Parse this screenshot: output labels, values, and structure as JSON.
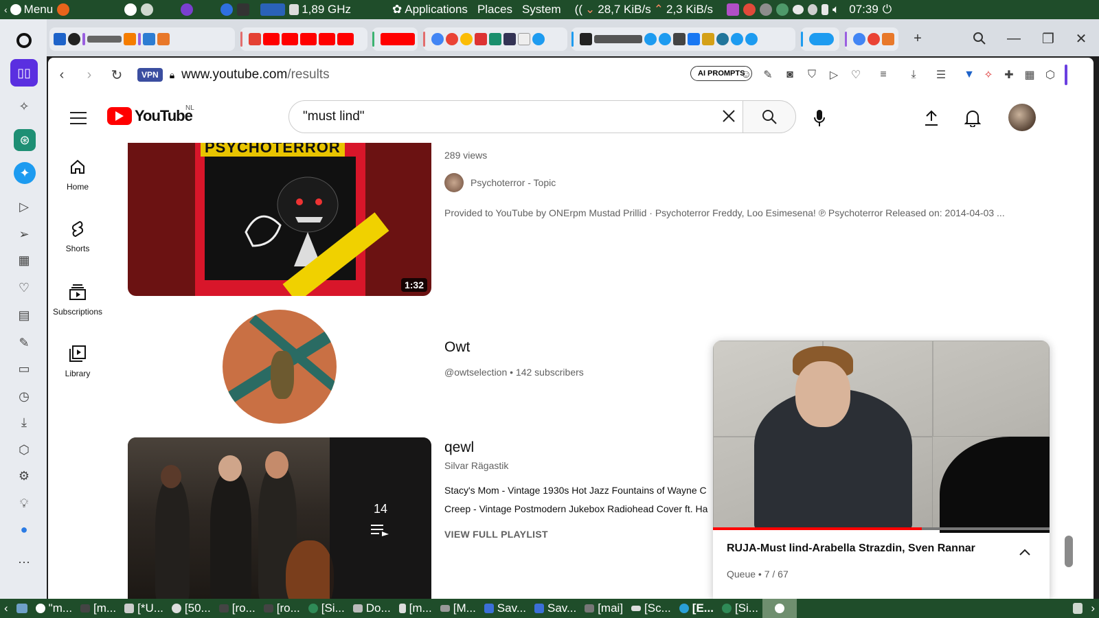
{
  "topbar": {
    "menu_label": "Menu",
    "cpu_freq": "1,89 GHz",
    "apps": [
      "Applications",
      "Places",
      "System"
    ],
    "net_down": "28,7 KiB/s",
    "net_up": "2,3 KiB/s",
    "clock": "07:39"
  },
  "address": {
    "vpn": "VPN",
    "url_host": "www.youtube.com",
    "url_path": "/results",
    "ai_prompts": "AI PROMPTS"
  },
  "youtube": {
    "logo_text": "YouTube",
    "region": "NL",
    "search_query": "\"must lind\"",
    "sidebar": [
      {
        "label": "Home",
        "icon": "home-icon"
      },
      {
        "label": "Shorts",
        "icon": "shorts-icon"
      },
      {
        "label": "Subscriptions",
        "icon": "subscriptions-icon"
      },
      {
        "label": "Library",
        "icon": "library-icon"
      }
    ],
    "result1": {
      "album_text": "PSYCHOTERROR",
      "duration": "1:32",
      "views": "289 views",
      "channel": "Psychoterror - Topic",
      "description": "Provided to YouTube by ONErpm Mustad Prillid · Psychoterror Freddy, Loo Esimesena! ℗ Psychoterror Released on: 2014-04-03 ..."
    },
    "result2": {
      "name": "Owt",
      "handle_meta": "@owtselection • 142 subscribers"
    },
    "result3": {
      "title": "qewl",
      "owner": "Silvar Rägastik",
      "count": "14",
      "lines": [
        "Stacy's Mom - Vintage 1930s Hot Jazz Fountains of Wayne C",
        "Creep - Vintage Postmodern Jukebox Radiohead Cover ft. Ha"
      ],
      "view_full": "VIEW FULL PLAYLIST"
    },
    "miniplayer": {
      "title": "RUJA-Must lind-Arabella Strazdin, Sven Rannar",
      "queue": "Queue • 7 / 67",
      "progress": 0.62
    }
  },
  "taskbar": {
    "items": [
      "\"m...",
      "[m...",
      "[*U...",
      "[50...",
      "[ro...",
      "[ro...",
      "[Si...",
      "Do...",
      "[m...",
      "[M...",
      "Sav...",
      "Sav...",
      "[mai]",
      "[Sc...",
      "[E...",
      "[Si..."
    ]
  },
  "colors": {
    "system_bar": "#1f4d2a",
    "yt_red": "#ff0000",
    "vpn_badge": "#3b4ea0"
  }
}
